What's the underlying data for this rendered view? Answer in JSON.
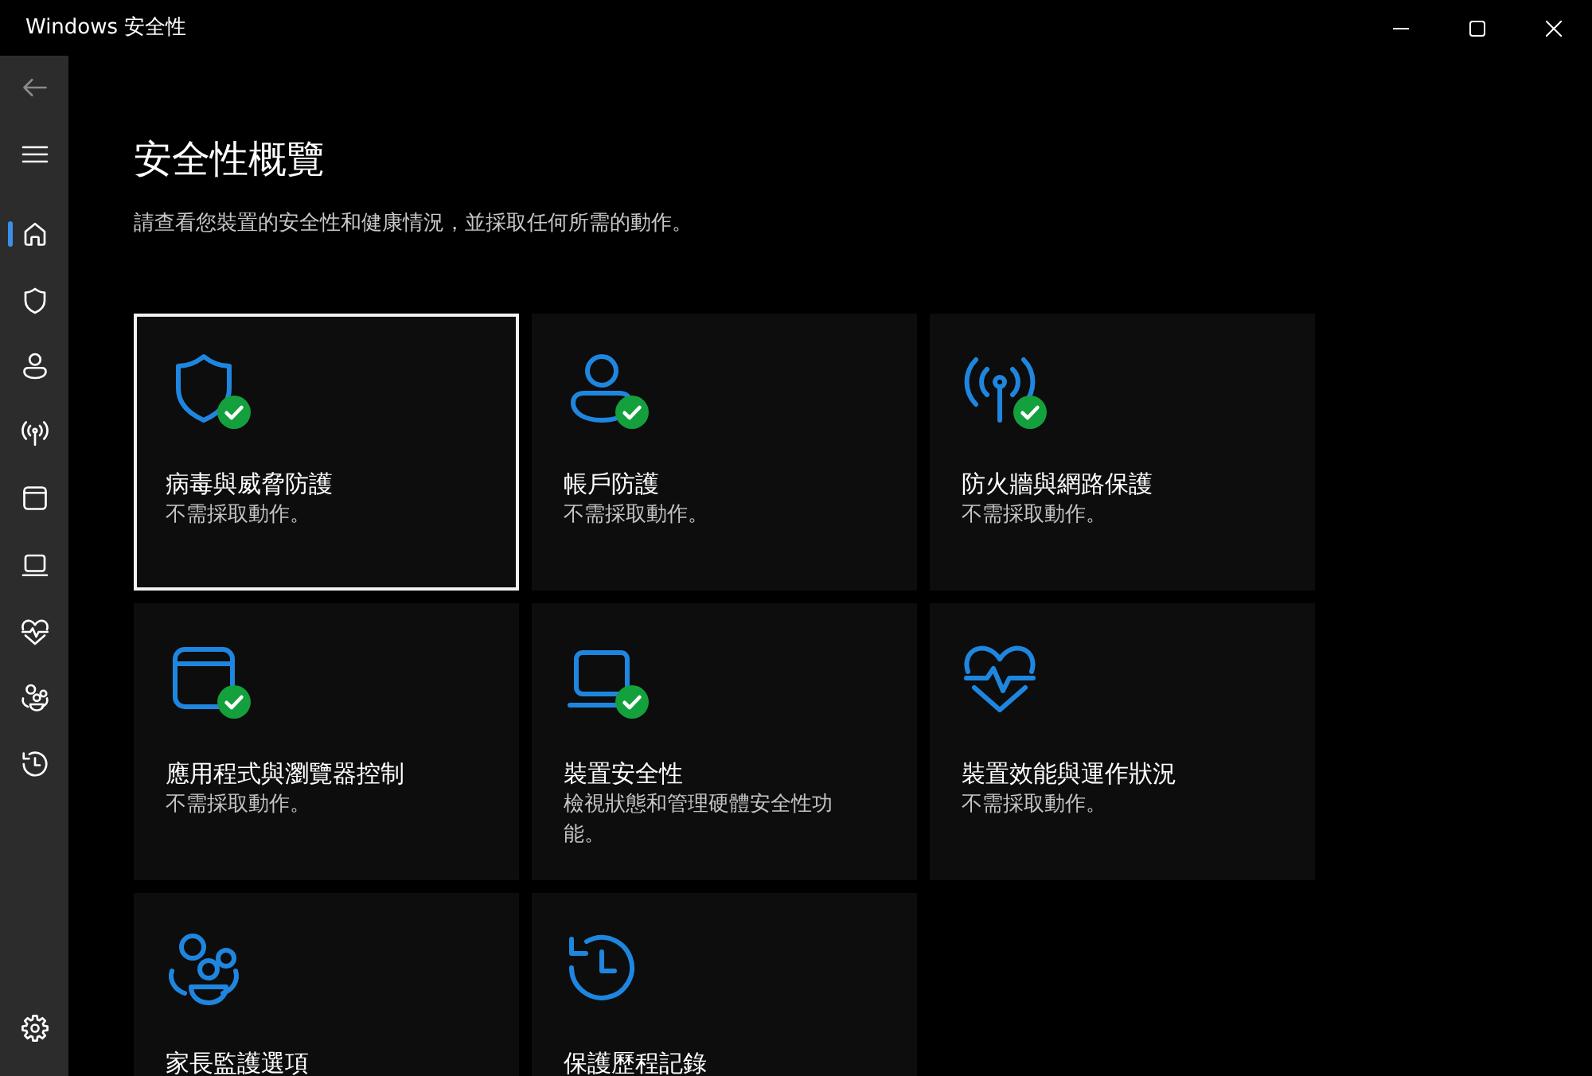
{
  "window": {
    "title": "Windows 安全性"
  },
  "sidebar": {
    "back": {
      "disabled": true
    },
    "items": [
      {
        "kind": "home",
        "selected": true
      },
      {
        "kind": "shield",
        "selected": false
      },
      {
        "kind": "person",
        "selected": false
      },
      {
        "kind": "antenna",
        "selected": false
      },
      {
        "kind": "window",
        "selected": false
      },
      {
        "kind": "laptop",
        "selected": false
      },
      {
        "kind": "heart",
        "selected": false
      },
      {
        "kind": "family",
        "selected": false
      },
      {
        "kind": "history",
        "selected": false
      }
    ],
    "settings": {
      "selected": false
    }
  },
  "page": {
    "title": "安全性概覽",
    "description": "請查看您裝置的安全性和健康情況，並採取任何所需的動作。"
  },
  "tiles": [
    {
      "kind": "shield",
      "title": "病毒與威脅防護",
      "status": "不需採取動作。",
      "ok": true,
      "selected": true
    },
    {
      "kind": "person",
      "title": "帳戶防護",
      "status": "不需採取動作。",
      "ok": true,
      "selected": false
    },
    {
      "kind": "antenna",
      "title": "防火牆與網路保護",
      "status": "不需採取動作。",
      "ok": true,
      "selected": false
    },
    {
      "kind": "window",
      "title": "應用程式與瀏覽器控制",
      "status": "不需採取動作。",
      "ok": true,
      "selected": false
    },
    {
      "kind": "laptop",
      "title": "裝置安全性",
      "status": "檢視狀態和管理硬體安全性功能。",
      "ok": true,
      "selected": false
    },
    {
      "kind": "heart",
      "title": "裝置效能與運作狀況",
      "status": "不需採取動作。",
      "ok": false,
      "selected": false
    },
    {
      "kind": "family",
      "title": "家長監護選項",
      "ok": false,
      "selected": false
    },
    {
      "kind": "history",
      "title": "保護歷程記錄",
      "ok": false,
      "selected": false
    }
  ]
}
